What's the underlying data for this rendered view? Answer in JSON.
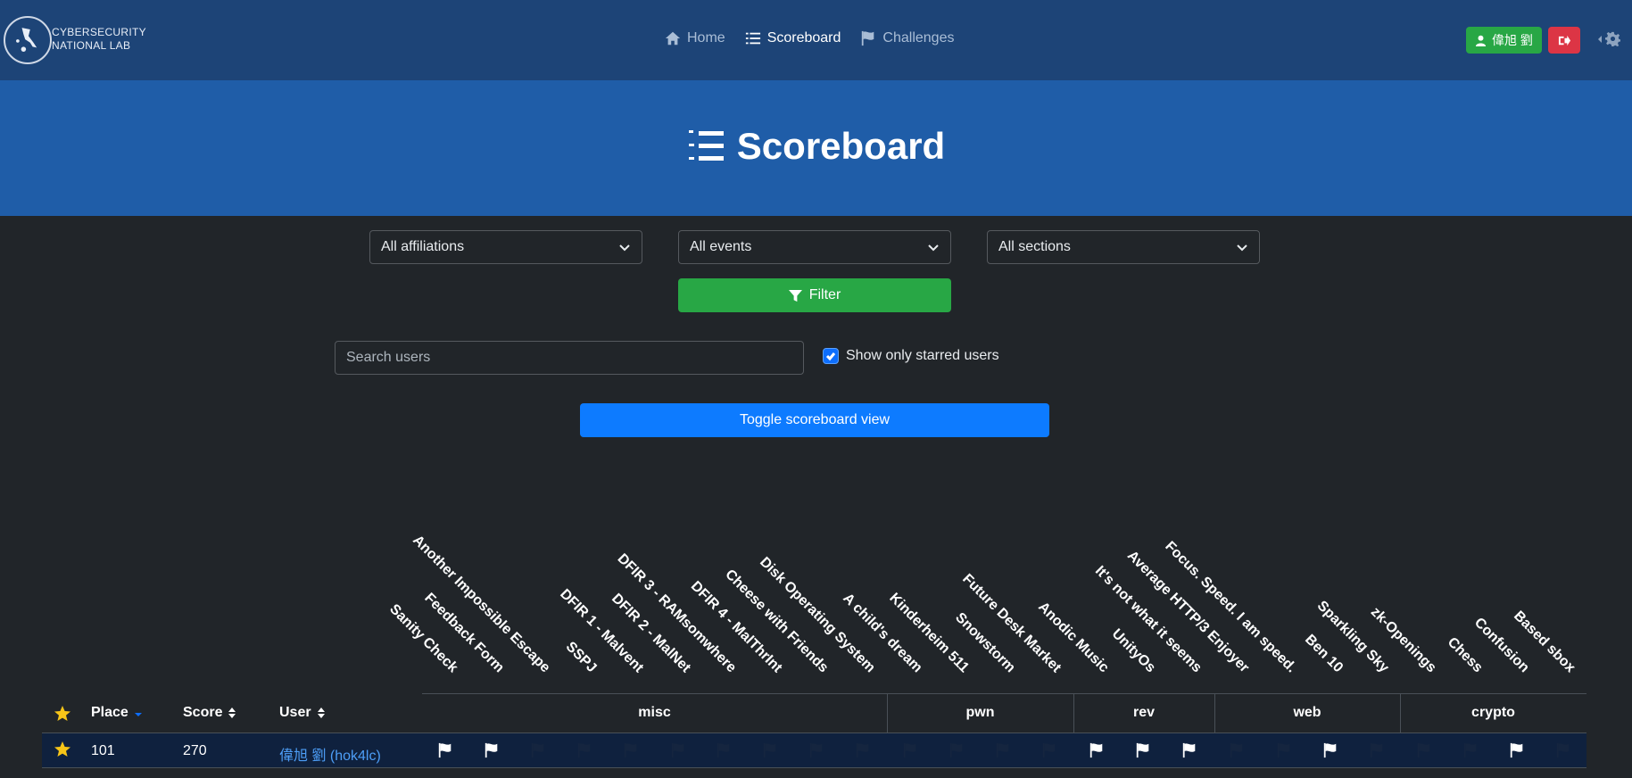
{
  "nav": {
    "logo_line1": "CYBERSECURITY",
    "logo_line2": "NATIONAL LAB",
    "links": [
      {
        "label": "Home",
        "icon": "home-icon"
      },
      {
        "label": "Scoreboard",
        "icon": "list-icon"
      },
      {
        "label": "Challenges",
        "icon": "flag-icon"
      }
    ],
    "user_label": "偉旭 劉",
    "colors": {
      "navbar": "#1d4477",
      "user": "#28a745",
      "logout": "#dc3545"
    }
  },
  "hero": {
    "title": "Scoreboard",
    "icon": "list-ol-icon"
  },
  "filters": {
    "affiliations": "All affiliations",
    "events": "All events",
    "sections": "All sections",
    "filter_label": "Filter"
  },
  "search": {
    "placeholder": "Search users",
    "starred_label": "Show only starred users",
    "starred_checked": true
  },
  "toggle_label": "Toggle scoreboard view",
  "challenges": [
    "Sanity Check",
    "Feedback Form",
    "Another Impossible Escape",
    "SSPJ",
    "DFIR 1 - Malvent",
    "DFIR 2 - MalNet",
    "DFIR 3 - RAMsomwhere",
    "DFIR 4 - MalThrInt",
    "Cheese with Friends",
    "Disk Operating System",
    "A child's dream",
    "Kinderheim 511",
    "Snowstorm",
    "Future Desk Market",
    "Anodic Music",
    "UnityOs",
    "It's not what it seems",
    "Average HTTP/3 Enjoyer",
    "Focus. Speed. I am speed.",
    "Ben 10",
    "Sparkling Sky",
    "zk-Openings",
    "Chess",
    "Confusion",
    "Based sbox"
  ],
  "table": {
    "headers": {
      "place": "Place",
      "score": "Score",
      "user": "User"
    },
    "categories": [
      "misc",
      "pwn",
      "rev",
      "web",
      "crypto"
    ],
    "rows": [
      {
        "place": "101",
        "score": "270",
        "user": "偉旭 劉 (hok4lc)",
        "solved": [
          true,
          true,
          false,
          false,
          false,
          false,
          false,
          false,
          false,
          false,
          false,
          false,
          false,
          false,
          true,
          true,
          true,
          false,
          false,
          true,
          false,
          false,
          false,
          true,
          false
        ]
      }
    ]
  }
}
